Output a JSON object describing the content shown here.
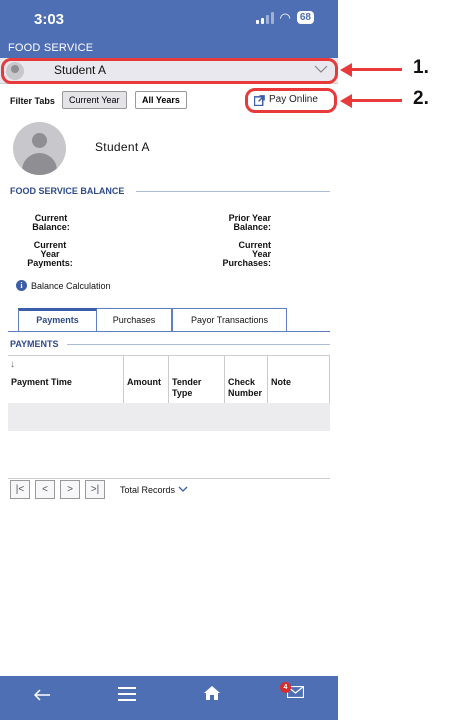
{
  "status_bar": {
    "time": "3:03",
    "battery": "68"
  },
  "header": {
    "title": "FOOD SERVICE"
  },
  "student_select": {
    "value": "Student A"
  },
  "filter": {
    "label": "Filter Tabs",
    "current_year": "Current Year",
    "all_years": "All Years",
    "pay_online": "Pay Online"
  },
  "profile": {
    "name": "Student A"
  },
  "balance": {
    "section_title": "FOOD SERVICE BALANCE",
    "current_balance_1": "Current",
    "current_balance_2": "Balance:",
    "prior_year_1": "Prior Year",
    "prior_year_2": "Balance:",
    "cyp_1": "Current",
    "cyp_2": "Year",
    "cyp_3": "Payments:",
    "cypu_1": "Current",
    "cypu_2": "Year",
    "cypu_3": "Purchases:",
    "calc_link": "Balance Calculation"
  },
  "tabs": [
    "Payments",
    "Purchases",
    "Payor Transactions"
  ],
  "payments": {
    "section_title": "PAYMENTS",
    "columns": [
      "Payment Time",
      "Amount",
      "Tender Type",
      "Check Number",
      "Note"
    ]
  },
  "pager": {
    "total_records": "Total Records"
  },
  "bottom_nav": {
    "mail_badge": "4"
  },
  "annotations": {
    "callout_1": "1.",
    "callout_2": "2."
  },
  "colors": {
    "brand": "#4f6fb5",
    "accent": "#e83a3a",
    "section": "#2d4a8a"
  }
}
